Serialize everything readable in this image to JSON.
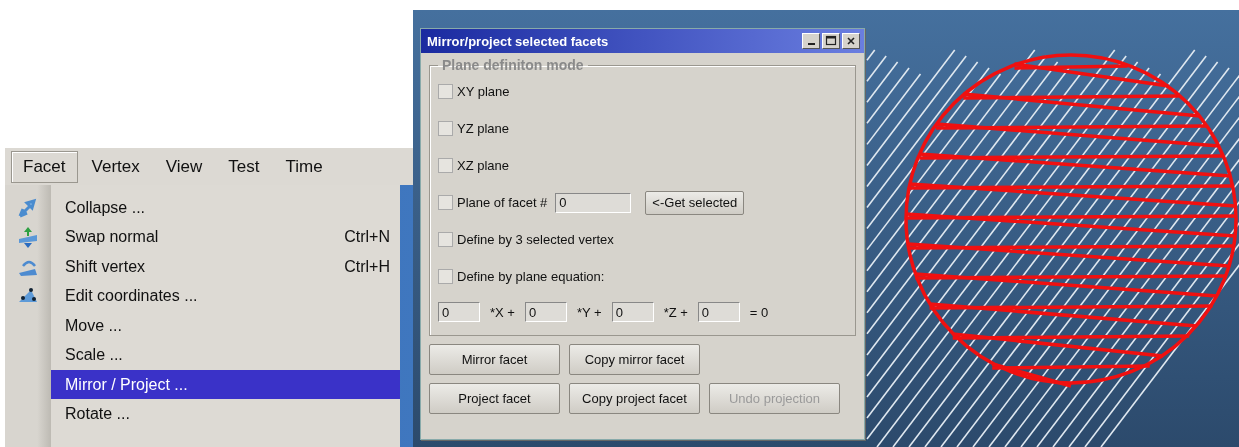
{
  "menu_bar": {
    "items": [
      {
        "label": "Facet",
        "selected": true
      },
      {
        "label": "Vertex",
        "selected": false
      },
      {
        "label": "View",
        "selected": false
      },
      {
        "label": "Test",
        "selected": false
      },
      {
        "label": "Time",
        "selected": false
      }
    ]
  },
  "menu": {
    "items": [
      {
        "label": "Collapse ...",
        "kind": "arrow",
        "selected": false
      },
      {
        "label": "Swap normal",
        "shortcut": "Ctrl+N",
        "kind": "flip",
        "selected": false
      },
      {
        "label": "Shift vertex",
        "shortcut": "Ctrl+H",
        "kind": "shift",
        "selected": false
      },
      {
        "label": "Edit coordinates ...",
        "kind": "points",
        "selected": false
      },
      {
        "label": "Move ...",
        "selected": false
      },
      {
        "label": "Scale ...",
        "selected": false
      },
      {
        "label": "Mirror / Project ...",
        "selected": true
      },
      {
        "label": "Rotate ...",
        "selected": false
      }
    ]
  },
  "dialog": {
    "title": "Mirror/project selected facets",
    "group": {
      "legend": "Plane definiton mode",
      "options": [
        {
          "kind": "plain",
          "label": "XY plane",
          "checked": false
        },
        {
          "kind": "plain",
          "label": "YZ plane",
          "checked": false
        },
        {
          "kind": "plain",
          "label": "XZ plane",
          "checked": false
        },
        {
          "kind": "facet",
          "label": "Plane of facet #",
          "checked": false,
          "value": "0",
          "button": "<-Get selected"
        },
        {
          "kind": "plain",
          "label": "Define by 3 selected vertex",
          "checked": false
        },
        {
          "kind": "plain",
          "label": "Define by plane equation:",
          "checked": false
        }
      ],
      "equation": [
        {
          "value": "0",
          "suffix": "*X +"
        },
        {
          "value": "0",
          "suffix": "*Y +"
        },
        {
          "value": "0",
          "suffix": "*Z +"
        },
        {
          "value": "0",
          "suffix": "= 0"
        }
      ]
    },
    "button_rows": [
      [
        {
          "label": "Mirror facet",
          "disabled": false
        },
        {
          "label": "Copy mirror facet",
          "disabled": false
        }
      ],
      [
        {
          "label": "Project facet",
          "disabled": false
        },
        {
          "label": "Copy project facet",
          "disabled": false
        },
        {
          "label": "Undo projection",
          "disabled": true
        }
      ]
    ]
  }
}
